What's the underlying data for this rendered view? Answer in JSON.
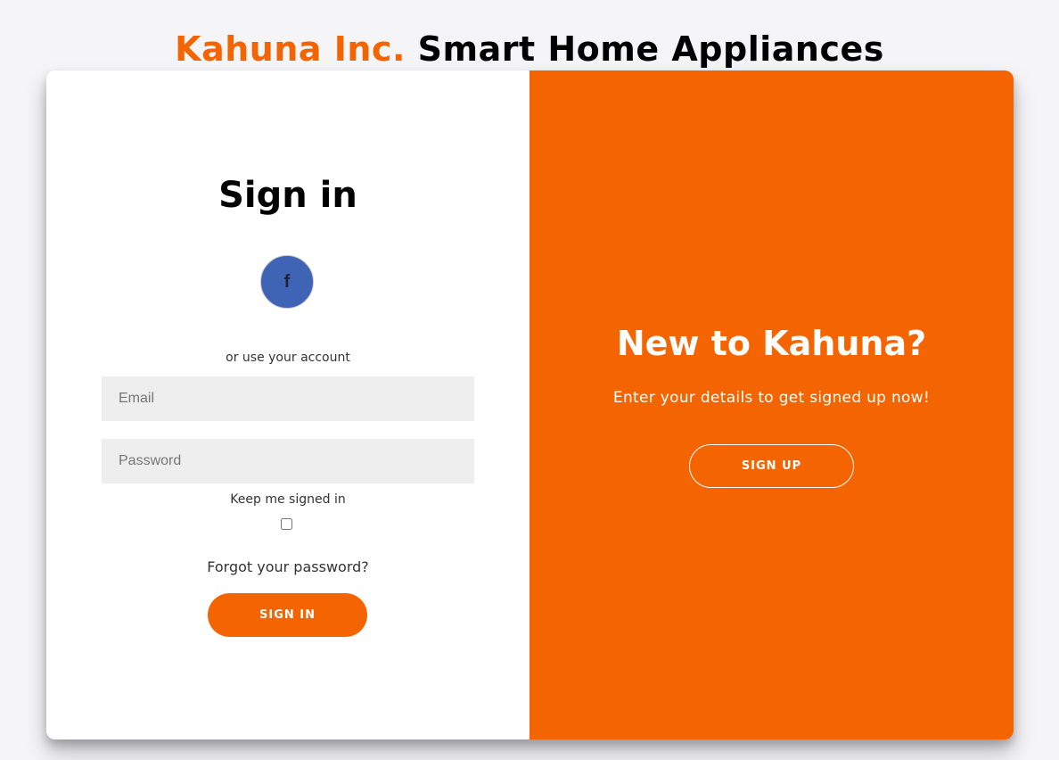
{
  "header": {
    "brand": "Kahuna Inc.",
    "tagline": "Smart Home Appliances"
  },
  "signin": {
    "title": "Sign in",
    "social": {
      "facebook_glyph": "f",
      "icon": "facebook-icon"
    },
    "alt_text": "or use your account",
    "email_placeholder": "Email",
    "email_value": "",
    "password_placeholder": "Password",
    "password_value": "",
    "keep_label": "Keep me signed in",
    "keep_checked": false,
    "forgot_text": "Forgot your password?",
    "button_label": "SIGN IN"
  },
  "signup": {
    "title": "New to Kahuna?",
    "subtitle": "Enter your details to get signed up now!",
    "button_label": "SIGN UP"
  },
  "colors": {
    "accent": "#f46501",
    "facebook": "#3f64b5",
    "input_bg": "#eeeeee",
    "page_bg": "#f5f5f8"
  }
}
